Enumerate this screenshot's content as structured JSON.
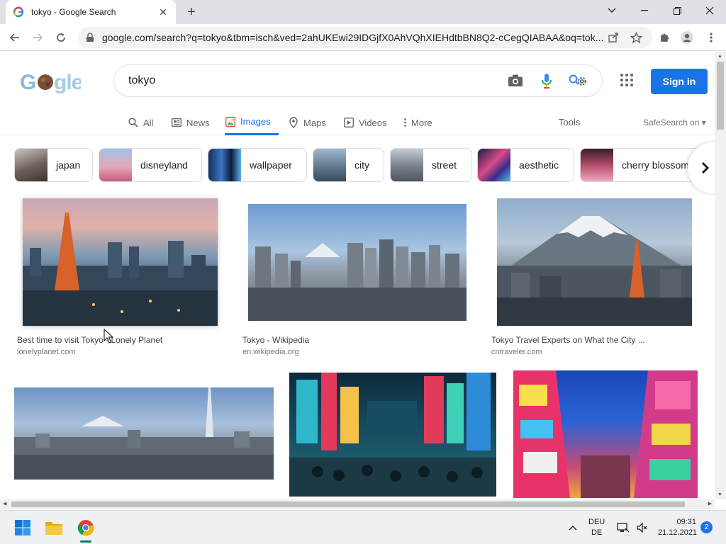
{
  "browser": {
    "tab_title": "tokyo - Google Search",
    "url": "google.com/search?q=tokyo&tbm=isch&ved=2ahUKEwi29IDGjfX0AhVQhXIEHdtbBN8Q2-cCegQIABAA&oq=tok..."
  },
  "search": {
    "query": "tokyo",
    "sign_in_label": "Sign in"
  },
  "nav": {
    "tabs": [
      {
        "label": "All",
        "icon": "search-icon"
      },
      {
        "label": "News",
        "icon": "news-icon"
      },
      {
        "label": "Images",
        "icon": "images-icon",
        "active": true
      },
      {
        "label": "Maps",
        "icon": "pin-icon"
      },
      {
        "label": "Videos",
        "icon": "play-icon"
      },
      {
        "label": "More",
        "icon": "more-vert-icon"
      }
    ],
    "tools_label": "Tools",
    "safesearch_label": "SafeSearch on"
  },
  "chips": [
    {
      "label": "japan",
      "color": "#7a6a66"
    },
    {
      "label": "disneyland",
      "color": "#d79aa8"
    },
    {
      "label": "wallpaper",
      "color": "#1f3a6a"
    },
    {
      "label": "city",
      "color": "#5d7f99"
    },
    {
      "label": "street",
      "color": "#7d8b98"
    },
    {
      "label": "aesthetic",
      "color": "#3a2a6a"
    },
    {
      "label": "cherry blossom",
      "color": "#a24a64"
    }
  ],
  "results": [
    {
      "title": "Best time to visit Tokyo - Lonely Planet",
      "source": "lonelyplanet.com"
    },
    {
      "title": "Tokyo - Wikipedia",
      "source": "en.wikipedia.org"
    },
    {
      "title": "Tokyo Travel Experts on What the City ...",
      "source": "cntraveler.com"
    },
    {
      "title": "",
      "source": ""
    },
    {
      "title": "",
      "source": ""
    },
    {
      "title": "",
      "source": ""
    }
  ],
  "taskbar": {
    "lang_top": "DEU",
    "lang_bottom": "DE",
    "time": "09:31",
    "date": "21.12.2021",
    "notifications": "2"
  },
  "colors": {
    "accent": "#1a73e8"
  }
}
